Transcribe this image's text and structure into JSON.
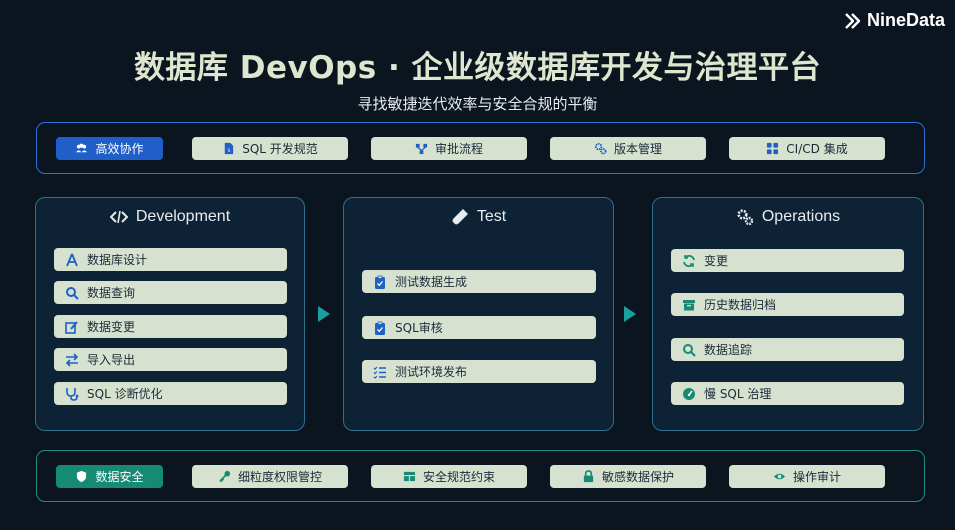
{
  "brand": {
    "name": "NineData"
  },
  "header": {
    "title": "数据库 DevOps · 企业级数据库开发与治理平台",
    "subtitle": "寻找敏捷迭代效率与安全合规的平衡"
  },
  "top_band": {
    "items": [
      {
        "label": "高效协作",
        "icon": "team-icon"
      },
      {
        "label": "SQL 开发规范",
        "icon": "sql-file-icon"
      },
      {
        "label": "审批流程",
        "icon": "flow-icon"
      },
      {
        "label": "版本管理",
        "icon": "gears-icon"
      },
      {
        "label": "CI/CD 集成",
        "icon": "grid-icon"
      }
    ]
  },
  "panels": [
    {
      "title": "Development",
      "icon": "code-icon",
      "items": [
        {
          "label": "数据库设计",
          "icon": "design-icon"
        },
        {
          "label": "数据查询",
          "icon": "search-icon"
        },
        {
          "label": "数据变更",
          "icon": "edit-icon"
        },
        {
          "label": "导入导出",
          "icon": "swap-icon"
        },
        {
          "label": "SQL 诊断优化",
          "icon": "stethoscope-icon"
        }
      ]
    },
    {
      "title": "Test",
      "icon": "flask-icon",
      "items": [
        {
          "label": "测试数据生成",
          "icon": "clipboard-icon"
        },
        {
          "label": "SQL审核",
          "icon": "clipboard-icon"
        },
        {
          "label": "测试环境发布",
          "icon": "checklist-icon"
        }
      ]
    },
    {
      "title": "Operations",
      "icon": "gears-icon",
      "items": [
        {
          "label": "变更",
          "icon": "refresh-icon"
        },
        {
          "label": "历史数据归档",
          "icon": "archive-icon"
        },
        {
          "label": "数据追踪",
          "icon": "search-icon"
        },
        {
          "label": "慢 SQL 治理",
          "icon": "gauge-icon"
        }
      ]
    }
  ],
  "bottom_band": {
    "items": [
      {
        "label": "数据安全",
        "icon": "shield-icon"
      },
      {
        "label": "细粒度权限管控",
        "icon": "key-icon"
      },
      {
        "label": "安全规范约束",
        "icon": "table-icon"
      },
      {
        "label": "敏感数据保护",
        "icon": "lock-icon"
      },
      {
        "label": "操作审计",
        "icon": "eye-icon"
      }
    ]
  },
  "colors": {
    "background": "#0a1520",
    "chip": "#d6e2cf",
    "accent_blue": "#1f5fc7",
    "accent_green": "#168a73",
    "arrow": "#1aa0a0"
  }
}
